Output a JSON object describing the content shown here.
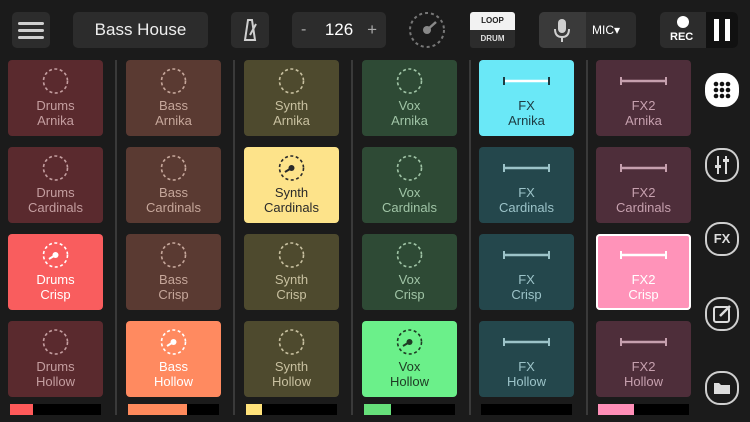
{
  "header": {
    "project_title": "Bass House",
    "tempo": {
      "minus_label": "-",
      "bpm": "126",
      "plus_label": "+"
    },
    "mode": {
      "loop_label": "LOOP",
      "drum_label": "DRUM"
    },
    "input": {
      "selected": "MIC",
      "arrow": "▾"
    },
    "record": {
      "label": "REC"
    }
  },
  "columns": [
    {
      "name": "Drums",
      "accent": "#ff5a5a",
      "level": 0.25,
      "pads": [
        {
          "name": "Drums",
          "kit": "Arnika",
          "bg": "#5a2a2e",
          "fg": "#c49ea0",
          "icon": "loop",
          "state": "idle"
        },
        {
          "name": "Drums",
          "kit": "Cardinals",
          "bg": "#5a2a2e",
          "fg": "#c49ea0",
          "icon": "loop",
          "state": "idle"
        },
        {
          "name": "Drums",
          "kit": "Crisp",
          "bg": "#f95d5e",
          "fg": "#ffffff",
          "icon": "loop",
          "state": "playing"
        },
        {
          "name": "Drums",
          "kit": "Hollow",
          "bg": "#5a2a2e",
          "fg": "#c49ea0",
          "icon": "loop",
          "state": "idle"
        }
      ]
    },
    {
      "name": "Bass",
      "accent": "#ff8a5c",
      "level": 0.65,
      "pads": [
        {
          "name": "Bass",
          "kit": "Arnika",
          "bg": "#5a3a32",
          "fg": "#c6a79b",
          "icon": "loop",
          "state": "idle"
        },
        {
          "name": "Bass",
          "kit": "Cardinals",
          "bg": "#5a3a32",
          "fg": "#c6a79b",
          "icon": "loop",
          "state": "idle"
        },
        {
          "name": "Bass",
          "kit": "Crisp",
          "bg": "#5a3a32",
          "fg": "#c6a79b",
          "icon": "loop",
          "state": "idle"
        },
        {
          "name": "Bass",
          "kit": "Hollow",
          "bg": "#ff8a60",
          "fg": "#ffffff",
          "icon": "loop",
          "state": "playing"
        }
      ]
    },
    {
      "name": "Synth",
      "accent": "#ffe27a",
      "level": 0.18,
      "pads": [
        {
          "name": "Synth",
          "kit": "Arnika",
          "bg": "#4e4a2e",
          "fg": "#c8c0a0",
          "icon": "loop",
          "state": "idle"
        },
        {
          "name": "Synth",
          "kit": "Cardinals",
          "bg": "#fde38a",
          "fg": "#2a2a2a",
          "icon": "loop",
          "state": "playing"
        },
        {
          "name": "Synth",
          "kit": "Crisp",
          "bg": "#4e4a2e",
          "fg": "#c8c0a0",
          "icon": "loop",
          "state": "idle"
        },
        {
          "name": "Synth",
          "kit": "Hollow",
          "bg": "#4e4a2e",
          "fg": "#c8c0a0",
          "icon": "loop",
          "state": "idle"
        }
      ]
    },
    {
      "name": "Vox",
      "accent": "#66e07a",
      "level": 0.3,
      "pads": [
        {
          "name": "Vox",
          "kit": "Arnika",
          "bg": "#2e4a35",
          "fg": "#a0c4a6",
          "icon": "loop",
          "state": "idle"
        },
        {
          "name": "Vox",
          "kit": "Cardinals",
          "bg": "#2e4a35",
          "fg": "#a0c4a6",
          "icon": "loop",
          "state": "idle"
        },
        {
          "name": "Vox",
          "kit": "Crisp",
          "bg": "#2e4a35",
          "fg": "#a0c4a6",
          "icon": "loop",
          "state": "idle"
        },
        {
          "name": "Vox",
          "kit": "Hollow",
          "bg": "#6bf08a",
          "fg": "#1e3a24",
          "icon": "loop",
          "state": "playing"
        }
      ]
    },
    {
      "name": "FX",
      "accent": "#66e8f5",
      "level": 0.0,
      "pads": [
        {
          "name": "FX",
          "kit": "Arnika",
          "bg": "#6ae8f7",
          "fg": "#1d3b42",
          "icon": "oneshot",
          "state": "playing"
        },
        {
          "name": "FX",
          "kit": "Cardinals",
          "bg": "#24474c",
          "fg": "#9cc3c8",
          "icon": "oneshot",
          "state": "idle"
        },
        {
          "name": "FX",
          "kit": "Crisp",
          "bg": "#24474c",
          "fg": "#9cc3c8",
          "icon": "oneshot",
          "state": "idle"
        },
        {
          "name": "FX",
          "kit": "Hollow",
          "bg": "#24474c",
          "fg": "#9cc3c8",
          "icon": "oneshot",
          "state": "idle"
        }
      ]
    },
    {
      "name": "FX2",
      "accent": "#ff8fb8",
      "level": 0.4,
      "pads": [
        {
          "name": "FX2",
          "kit": "Arnika",
          "bg": "#4e2e3a",
          "fg": "#c6a0ae",
          "icon": "oneshot",
          "state": "idle"
        },
        {
          "name": "FX2",
          "kit": "Cardinals",
          "bg": "#4e2e3a",
          "fg": "#c6a0ae",
          "icon": "oneshot",
          "state": "idle"
        },
        {
          "name": "FX2",
          "kit": "Crisp",
          "bg": "#ff93b9",
          "fg": "#ffffff",
          "icon": "oneshot",
          "state": "selected"
        },
        {
          "name": "FX2",
          "kit": "Hollow",
          "bg": "#4e2e3a",
          "fg": "#c6a0ae",
          "icon": "oneshot",
          "state": "idle"
        }
      ]
    }
  ],
  "sidebar": {
    "fx_label": "FX"
  }
}
